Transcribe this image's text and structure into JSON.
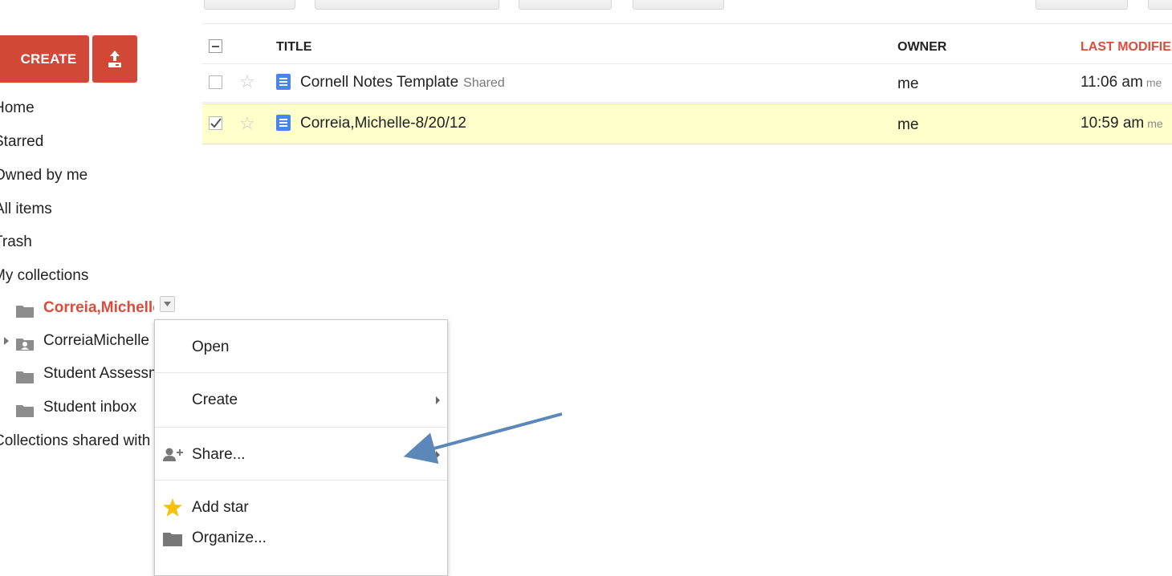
{
  "sidebar": {
    "create_label": "CREATE",
    "upload_icon": "upload-icon",
    "nav_items": [
      "Home",
      "Starred",
      "Owned by me",
      "All items",
      "Trash",
      "My collections"
    ],
    "collections": [
      {
        "label": "Correia,Michelle",
        "active": true
      },
      {
        "label": "CorreiaMichelle",
        "active": false,
        "expandable": true
      },
      {
        "label": "Student Assessments",
        "active": false
      },
      {
        "label": "Student inbox",
        "active": false
      }
    ],
    "shared_label": "Collections shared with me"
  },
  "list": {
    "headers": {
      "title": "TITLE",
      "owner": "OWNER",
      "modified": "LAST MODIFIED"
    },
    "rows": [
      {
        "title": "Cornell Notes Template",
        "badge": "Shared",
        "owner": "me",
        "modified": "11:06 am",
        "by": "me",
        "checked": false,
        "selected": false
      },
      {
        "title": "Correia,Michelle-8/20/12",
        "badge": "",
        "owner": "me",
        "modified": "10:59 am",
        "by": "me",
        "checked": true,
        "selected": true
      }
    ]
  },
  "context_menu": {
    "items": [
      {
        "label": "Open"
      },
      {
        "label": "Create",
        "submenu": true
      },
      {
        "label": "Share...",
        "icon": "add-person-icon",
        "submenu": true
      },
      {
        "label": "Add star",
        "icon": "star-icon"
      },
      {
        "label": "Organize...",
        "icon": "folder-icon"
      }
    ]
  },
  "colors": {
    "brand_red": "#d14836",
    "selected_row": "#ffffcc",
    "annotation_arrow": "#5b87b9",
    "header_sorted": "#dd4b39"
  }
}
